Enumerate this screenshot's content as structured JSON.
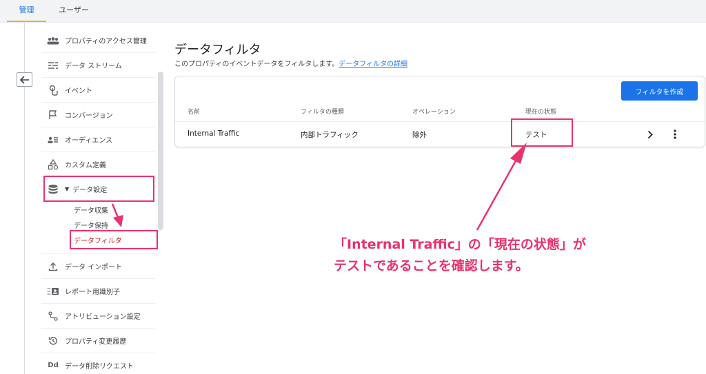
{
  "tabs": [
    {
      "label": "管理",
      "active": true
    },
    {
      "label": "ユーザー",
      "active": false
    }
  ],
  "sidebar": {
    "items": [
      {
        "label": "プロパティのアクセス管理",
        "icon": "people-icon"
      },
      {
        "label": "データ ストリーム",
        "icon": "stream-icon"
      },
      {
        "label": "イベント",
        "icon": "touch-icon"
      },
      {
        "label": "コンバージョン",
        "icon": "flag-icon"
      },
      {
        "label": "オーディエンス",
        "icon": "audience-icon"
      },
      {
        "label": "カスタム定義",
        "icon": "shapes-icon"
      },
      {
        "label": "データ設定",
        "icon": "database-icon",
        "expanded": true
      }
    ],
    "sub_items": [
      {
        "label": "データ収集",
        "active": false
      },
      {
        "label": "データ保持",
        "active": false
      },
      {
        "label": "データフィルタ",
        "active": true
      }
    ],
    "items_after": [
      {
        "label": "データ インポート",
        "icon": "upload-icon"
      },
      {
        "label": "レポート用識別子",
        "icon": "identity-icon"
      },
      {
        "label": "アトリビューション設定",
        "icon": "attribution-icon"
      },
      {
        "label": "プロパティ変更履歴",
        "icon": "history-icon"
      },
      {
        "label": "データ削除リクエスト",
        "icon": "data-deletion-icon"
      }
    ]
  },
  "main": {
    "title": "データフィルタ",
    "description": "このプロパティのイベントデータをフィルタします。",
    "details_link": "データフィルタの詳細",
    "create_button": "フィルタを作成",
    "table": {
      "headers": [
        "名前",
        "フィルタの種類",
        "オペレーション",
        "現在の状態"
      ],
      "rows": [
        {
          "name": "Internal Traffic",
          "type": "内部トラフィック",
          "operation": "除外",
          "state": "テスト"
        }
      ]
    }
  },
  "annotation": {
    "line1": "「Internal Traffic」の「現在の状態」が",
    "line2": "テストであることを確認します。",
    "color": "#e8336d"
  },
  "colors": {
    "accent": "#1a73e8",
    "tab_indicator": "#f9ab00",
    "highlight": "#e8336d"
  }
}
